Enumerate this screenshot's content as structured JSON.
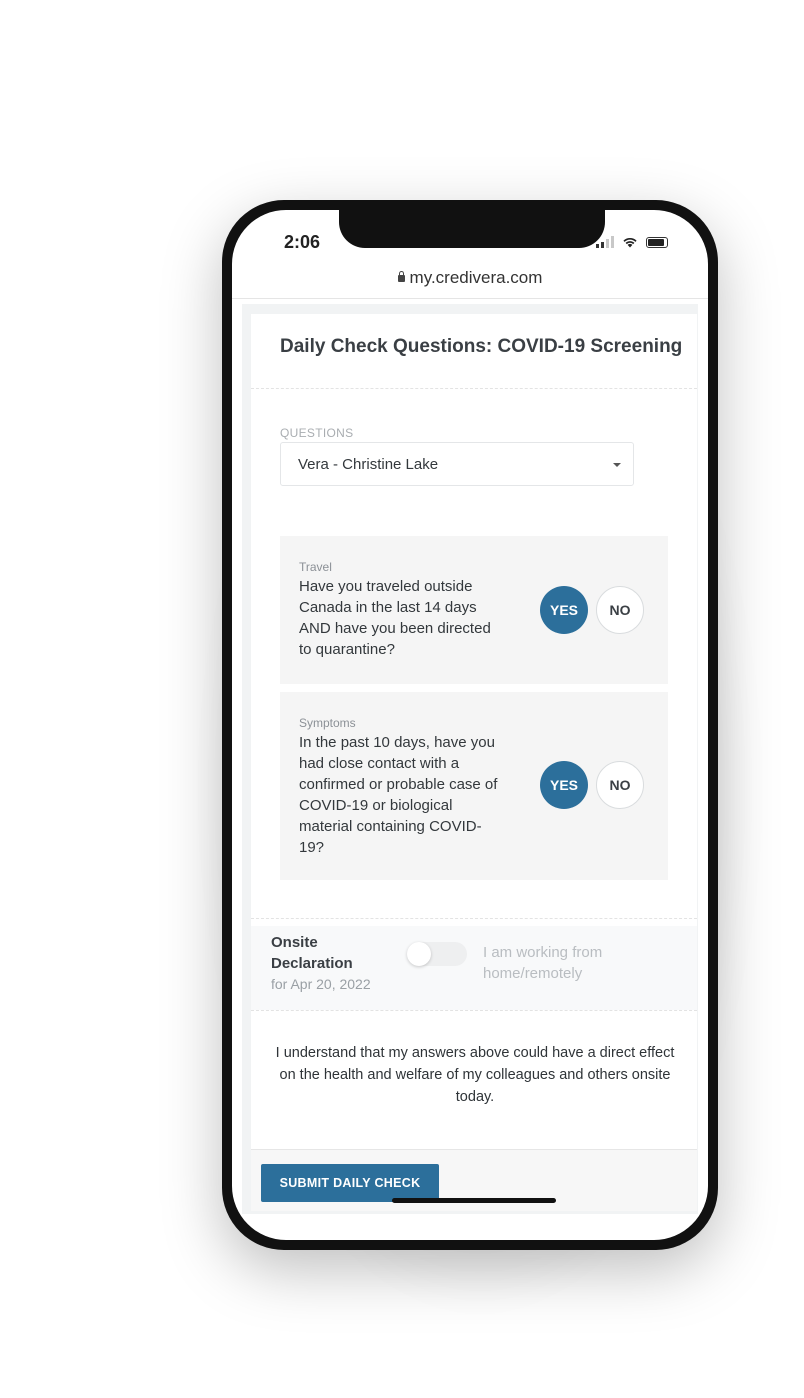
{
  "status_bar": {
    "time": "2:06"
  },
  "browser": {
    "url": "my.credivera.com"
  },
  "card": {
    "title": "Daily Check Questions: COVID-19 Screening",
    "questions_label": "QUESTIONS",
    "questions_select_value": "Vera - Christine Lake"
  },
  "questions": [
    {
      "category": "Travel",
      "text": "Have you traveled outside Canada in the last 14 days AND have you been directed to quarantine?",
      "yes_label": "YES",
      "no_label": "NO",
      "selected": "YES"
    },
    {
      "category": "Symptoms",
      "text": "In the past 10 days, have you had close contact with a confirmed or probable case of COVID-19 or biological material containing COVID-19?",
      "yes_label": "YES",
      "no_label": "NO",
      "selected": "YES"
    }
  ],
  "onsite": {
    "title": "Onsite Declaration",
    "date": "for Apr 20, 2022",
    "toggle_label": "I am working from home/remotely",
    "toggle_on": false
  },
  "disclaimer": "I understand that my answers above could have a direct effect on the health and welfare of my colleagues and others onsite today.",
  "submit_label": "SUBMIT DAILY CHECK",
  "colors": {
    "accent": "#2c6f9b"
  }
}
